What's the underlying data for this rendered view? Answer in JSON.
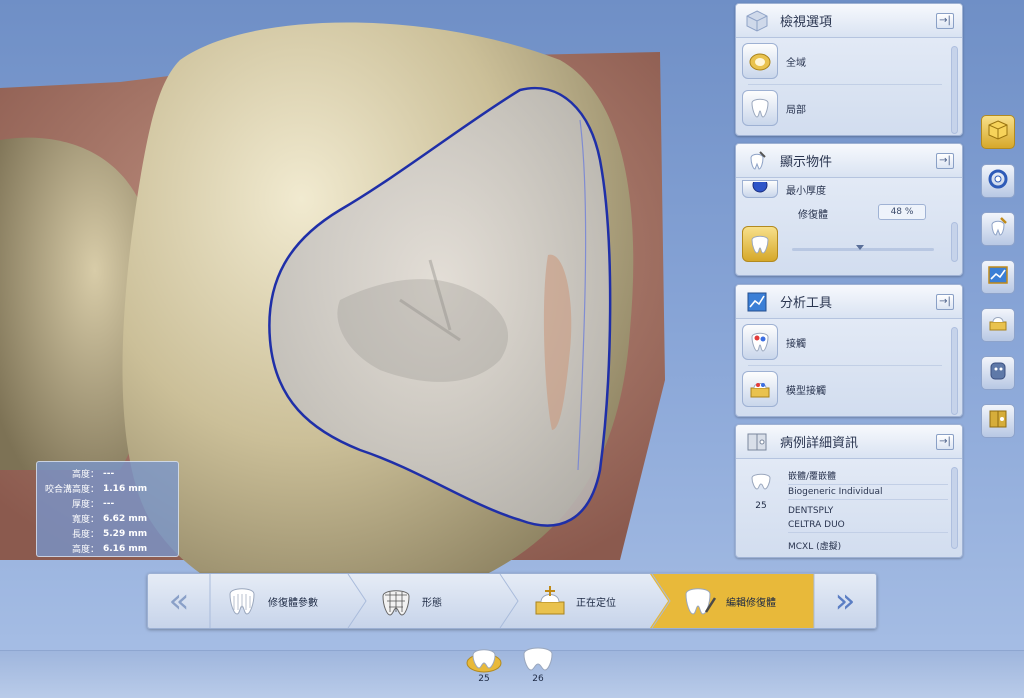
{
  "measurements": [
    {
      "label": "高度：",
      "value": "---"
    },
    {
      "label": "咬合溝高度：",
      "value": "1.16 mm"
    },
    {
      "label": "厚度：",
      "value": "---"
    },
    {
      "label": "寬度：",
      "value": "6.62 mm"
    },
    {
      "label": "長度：",
      "value": "5.29 mm"
    },
    {
      "label": "高度：",
      "value": "6.16 mm"
    }
  ],
  "panels": {
    "view_options": {
      "title": "檢視選項",
      "collapse_icon": "→|",
      "items": [
        {
          "label": "全域",
          "icon": "jaw-full-icon"
        },
        {
          "label": "局部",
          "icon": "tooth-single-icon"
        }
      ]
    },
    "display_objects": {
      "title": "顯示物件",
      "collapse_icon": "→|",
      "items": [
        {
          "label": "最小厚度",
          "icon": "min-thickness-icon"
        },
        {
          "label": "修復體",
          "icon": "restoration-icon",
          "value": "48 %",
          "fraction": 0.48
        }
      ]
    },
    "analysis_tools": {
      "title": "分析工具",
      "collapse_icon": "→|",
      "items": [
        {
          "label": "接觸",
          "icon": "contact-icon"
        },
        {
          "label": "模型接觸",
          "icon": "model-contact-icon"
        }
      ]
    },
    "case_details": {
      "title": "病例詳細資訊",
      "collapse_icon": "→|",
      "tooth_number": "25",
      "rows": [
        "嵌體/覆嵌體",
        "Biogeneric Individual",
        "DENTSPLY",
        "CELTRA DUO",
        "MCXL (虛擬)"
      ]
    }
  },
  "workflow": {
    "prev_label": "«",
    "next_label": "»",
    "steps": [
      {
        "label": "修復體參數",
        "icon": "parameters-icon",
        "active": false
      },
      {
        "label": "形態",
        "icon": "morphology-icon",
        "active": false
      },
      {
        "label": "正在定位",
        "icon": "positioning-icon",
        "active": false
      },
      {
        "label": "編輯修復體",
        "icon": "edit-restoration-icon",
        "active": true
      }
    ]
  },
  "tooth_bar": [
    {
      "number": "25",
      "selected": true
    },
    {
      "number": "26",
      "selected": false
    }
  ],
  "colors": {
    "accent_gold": "#e7b93a",
    "margin_line": "#1f2fa8",
    "panel_bg": "#dfe7f4"
  }
}
